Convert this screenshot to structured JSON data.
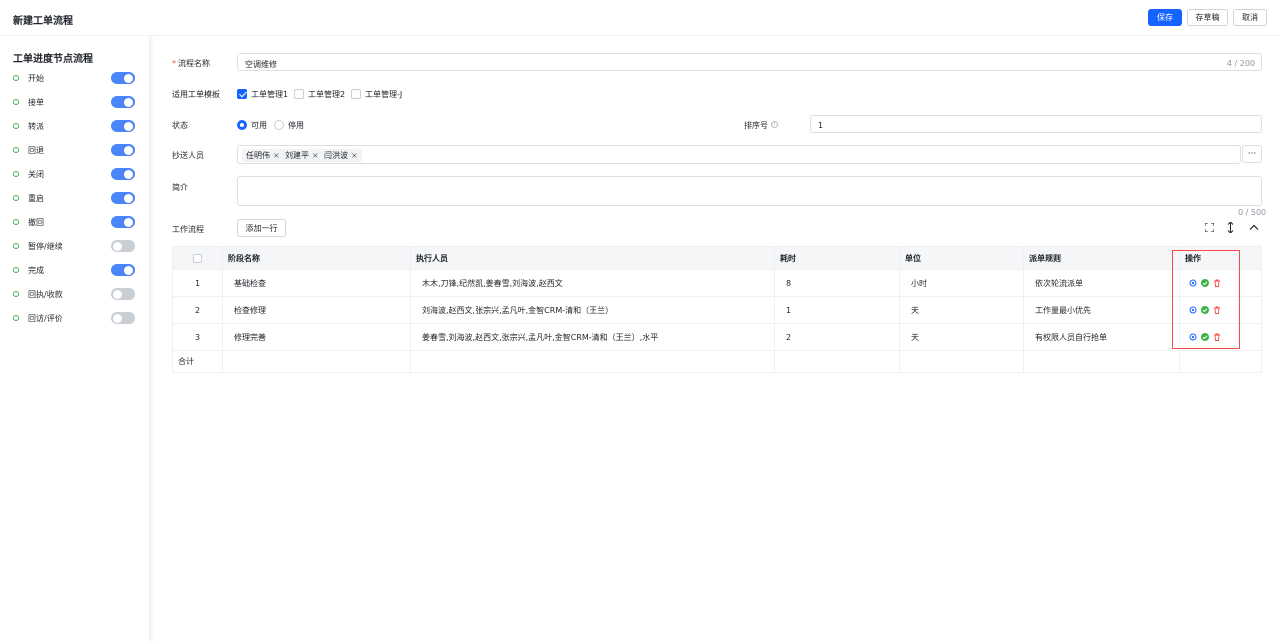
{
  "header": {
    "title": "新建工单流程",
    "save_label": "保存",
    "draft_label": "存草稿",
    "cancel_label": "取消"
  },
  "sidebar": {
    "title": "工单进度节点流程",
    "items": [
      {
        "label": "开始",
        "enabled": true
      },
      {
        "label": "接单",
        "enabled": true
      },
      {
        "label": "转派",
        "enabled": true
      },
      {
        "label": "回退",
        "enabled": true
      },
      {
        "label": "关闭",
        "enabled": true
      },
      {
        "label": "重启",
        "enabled": true
      },
      {
        "label": "撤回",
        "enabled": true
      },
      {
        "label": "暂停/继续",
        "enabled": false
      },
      {
        "label": "完成",
        "enabled": true
      },
      {
        "label": "回执/收款",
        "enabled": false
      },
      {
        "label": "回访/评价",
        "enabled": false
      }
    ]
  },
  "form": {
    "name_label": "流程名称",
    "name_required_mark": "*",
    "name_value": "空调维修",
    "name_count": "4 / 200",
    "template_label": "适用工单模板",
    "templates": [
      {
        "label": "工单管理1",
        "checked": true
      },
      {
        "label": "工单管理2",
        "checked": false
      },
      {
        "label": "工单管理-J",
        "checked": false
      }
    ],
    "status_label": "状态",
    "status_options": [
      {
        "label": "可用",
        "selected": true
      },
      {
        "label": "停用",
        "selected": false
      }
    ],
    "sort_label": "排序号",
    "sort_value": "1",
    "cc_label": "抄送人员",
    "cc_people": [
      "任明伟",
      "刘建平",
      "闫洪波"
    ],
    "cc_more": "···",
    "intro_label": "简介",
    "intro_count": "0 / 500",
    "workflow_label": "工作流程",
    "add_row_label": "添加一行"
  },
  "table": {
    "headers": [
      "",
      "阶段名称",
      "执行人员",
      "耗时",
      "单位",
      "派单规则",
      "操作"
    ],
    "rows": [
      {
        "no": "1",
        "stage": "基础检查",
        "staff": "木木,刀锋,纪然凯,姜春雪,刘海波,赵西文",
        "time": "8",
        "unit": "小时",
        "rule": "依次轮流派单"
      },
      {
        "no": "2",
        "stage": "检查修理",
        "staff": "刘海波,赵西文,张宗兴,孟凡叶,金智CRM-清和（王兰）",
        "time": "1",
        "unit": "天",
        "rule": "工作量最小优先"
      },
      {
        "no": "3",
        "stage": "修理完善",
        "staff": "姜春雪,刘海波,赵西文,张宗兴,孟凡叶,金智CRM-清和（王兰）,水平",
        "time": "2",
        "unit": "天",
        "rule": "有权限人员自行抢单"
      }
    ],
    "total_label": "合计"
  },
  "colors": {
    "primary": "#1664ff",
    "switch_on": "#4a86f7",
    "switch_off": "#c9cdd4",
    "node_dot": "#3bb346",
    "highlight_box": "#f54a45",
    "gear_icon": "#1664ff",
    "check_icon": "#3bb346",
    "delete_icon": "#f54a45"
  }
}
